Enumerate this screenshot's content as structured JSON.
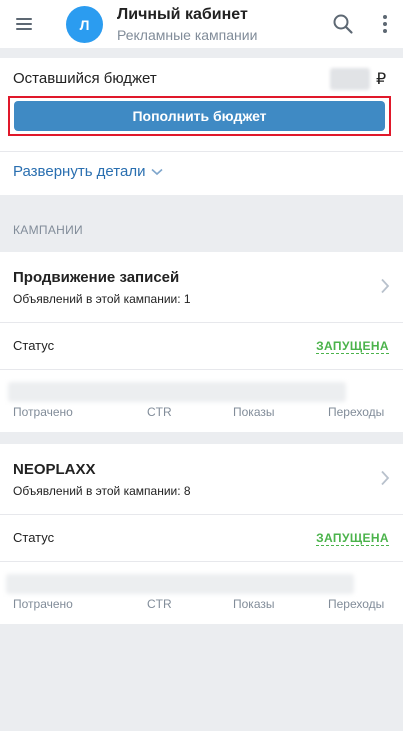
{
  "header": {
    "avatar_letter": "Л",
    "title": "Личный кабинет",
    "subtitle": "Рекламные кампании"
  },
  "budget": {
    "label": "Оставшийся бюджет",
    "currency": "₽",
    "topup_button": "Пополнить бюджет",
    "expand_link": "Развернуть детали"
  },
  "campaigns_section": {
    "label": "КАМПАНИИ",
    "items": [
      {
        "name": "Продвижение записей",
        "ads": "Объявлений в этой кампании: 1",
        "status_label": "Статус",
        "status_value": "ЗАПУЩЕНА",
        "stats": [
          "Потрачено",
          "CTR",
          "Показы",
          "Переходы"
        ]
      },
      {
        "name": "NEOPLAXX",
        "ads": "Объявлений в этой кампании: 8",
        "status_label": "Статус",
        "status_value": "ЗАПУЩЕНА",
        "stats": [
          "Потрачено",
          "CTR",
          "Показы",
          "Переходы"
        ]
      }
    ]
  },
  "colors": {
    "accent": "#3f8ac4",
    "highlight_frame": "#e0182a",
    "status_active": "#4bb34b",
    "avatar": "#2b9cf0",
    "background": "#ebedf0"
  },
  "icons": [
    "menu-icon",
    "search-icon",
    "more-vertical-icon",
    "chevron-down-icon",
    "chevron-right-icon"
  ]
}
